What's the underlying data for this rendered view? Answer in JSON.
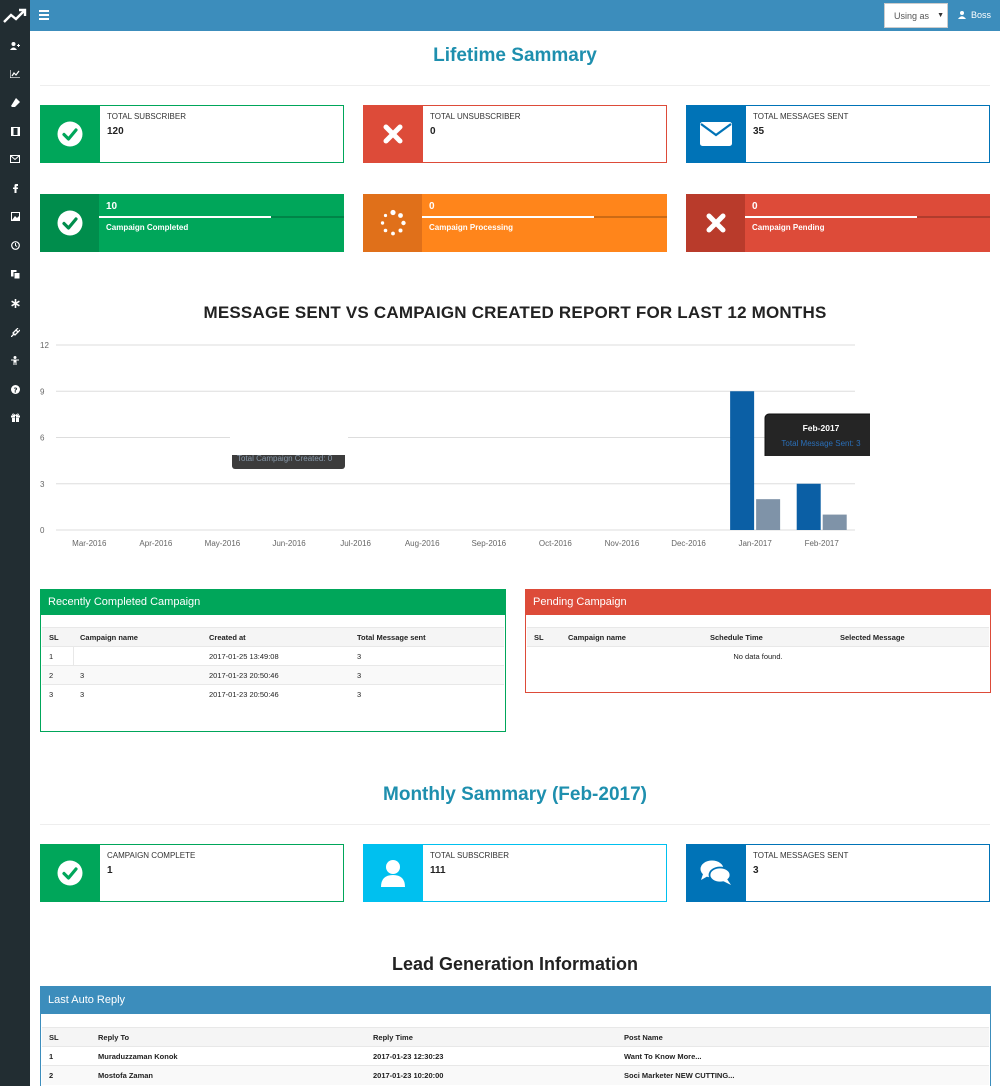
{
  "topbar": {
    "using_as": "Using as",
    "user_name": "Boss"
  },
  "sidebar": {
    "icons": [
      "add-user-icon",
      "chart-line-icon",
      "eraser-icon",
      "film-icon",
      "envelope-icon",
      "facebook-icon",
      "image-icon",
      "clock-icon",
      "copy-icon",
      "asterisk-icon",
      "plug-icon",
      "person-icon",
      "question-icon",
      "gift-icon"
    ]
  },
  "lifetime": {
    "title": "Lifetime Sammary",
    "boxes": [
      {
        "label": "TOTAL SUBSCRIBER",
        "value": "120",
        "color": "#00a65a",
        "icon": "check-circle-icon"
      },
      {
        "label": "TOTAL UNSUBSCRIBER",
        "value": "0",
        "color": "#dd4b39",
        "icon": "times-icon"
      },
      {
        "label": "TOTAL MESSAGES SENT",
        "value": "35",
        "color": "#0073b7",
        "icon": "envelope-icon"
      }
    ],
    "progress": [
      {
        "number": "10",
        "text": "Campaign Completed",
        "color": "#00a65a",
        "fill": 0.7,
        "icon": "check-circle-icon"
      },
      {
        "number": "0",
        "text": "Campaign Processing",
        "color": "#ff851b",
        "fill": 0.7,
        "icon": "spinner-icon"
      },
      {
        "number": "0",
        "text": "Campaign Pending",
        "color": "#dd4b39",
        "fill": 0.7,
        "icon": "times-icon"
      }
    ]
  },
  "chart_title": "MESSAGE SENT VS CAMPAIGN CREATED REPORT FOR LAST 12 MONTHS",
  "chart_data": {
    "type": "bar",
    "categories": [
      "Mar-2016",
      "Apr-2016",
      "May-2016",
      "Jun-2016",
      "Jul-2016",
      "Aug-2016",
      "Sep-2016",
      "Oct-2016",
      "Nov-2016",
      "Dec-2016",
      "Jan-2017",
      "Feb-2017"
    ],
    "series": [
      {
        "values": [
          0,
          0,
          0,
          0,
          0,
          0,
          0,
          0,
          0,
          0,
          9,
          3
        ],
        "color": "#0b5fa5"
      },
      {
        "values": [
          0,
          0,
          0,
          0,
          0,
          0,
          0,
          0,
          0,
          0,
          2,
          1
        ],
        "color": "#7f93a8"
      }
    ],
    "yticks": [
      0,
      3,
      6,
      9,
      12
    ],
    "ylim": [
      0,
      12
    ],
    "grid": true,
    "tooltip": {
      "title": "Feb-2017",
      "line1": "Total Message Sent: 3"
    },
    "ghost_tooltip_text": "Total Campaign Created: 0"
  },
  "completed_panel": {
    "title": "Recently Completed Campaign",
    "headers": [
      "SL",
      "Campaign name",
      "Created at",
      "Total Message sent"
    ],
    "rows": [
      [
        "1",
        "",
        "2017-01-25 13:49:08",
        "3"
      ],
      [
        "2",
        "3",
        "2017-01-23 20:50:46",
        "3"
      ],
      [
        "3",
        "3",
        "2017-01-23 20:50:46",
        "3"
      ]
    ]
  },
  "pending_panel": {
    "title": "Pending Campaign",
    "headers": [
      "SL",
      "Campaign name",
      "Schedule Time",
      "Selected Message"
    ],
    "empty": "No data found."
  },
  "monthly": {
    "title": "Monthly Sammary (Feb-2017)",
    "boxes": [
      {
        "label": "CAMPAIGN COMPLETE",
        "value": "1",
        "color": "#00a65a",
        "icon": "check-circle-icon"
      },
      {
        "label": "TOTAL SUBSCRIBER",
        "value": "111",
        "color": "#00c0ef",
        "icon": "user-icon"
      },
      {
        "label": "TOTAL MESSAGES SENT",
        "value": "3",
        "color": "#0073b7",
        "icon": "comments-icon"
      }
    ]
  },
  "lead": {
    "title": "Lead Generation Information",
    "panel_title": "Last Auto Reply",
    "headers": [
      "SL",
      "Reply To",
      "Reply Time",
      "Post Name"
    ],
    "rows": [
      [
        "1",
        "Muraduzzaman Konok",
        "2017-01-23 12:30:23",
        "Want To Know More..."
      ],
      [
        "2",
        "Mostofa Zaman",
        "2017-01-23 10:20:00",
        "Soci Marketer NEW CUTTING..."
      ]
    ]
  }
}
